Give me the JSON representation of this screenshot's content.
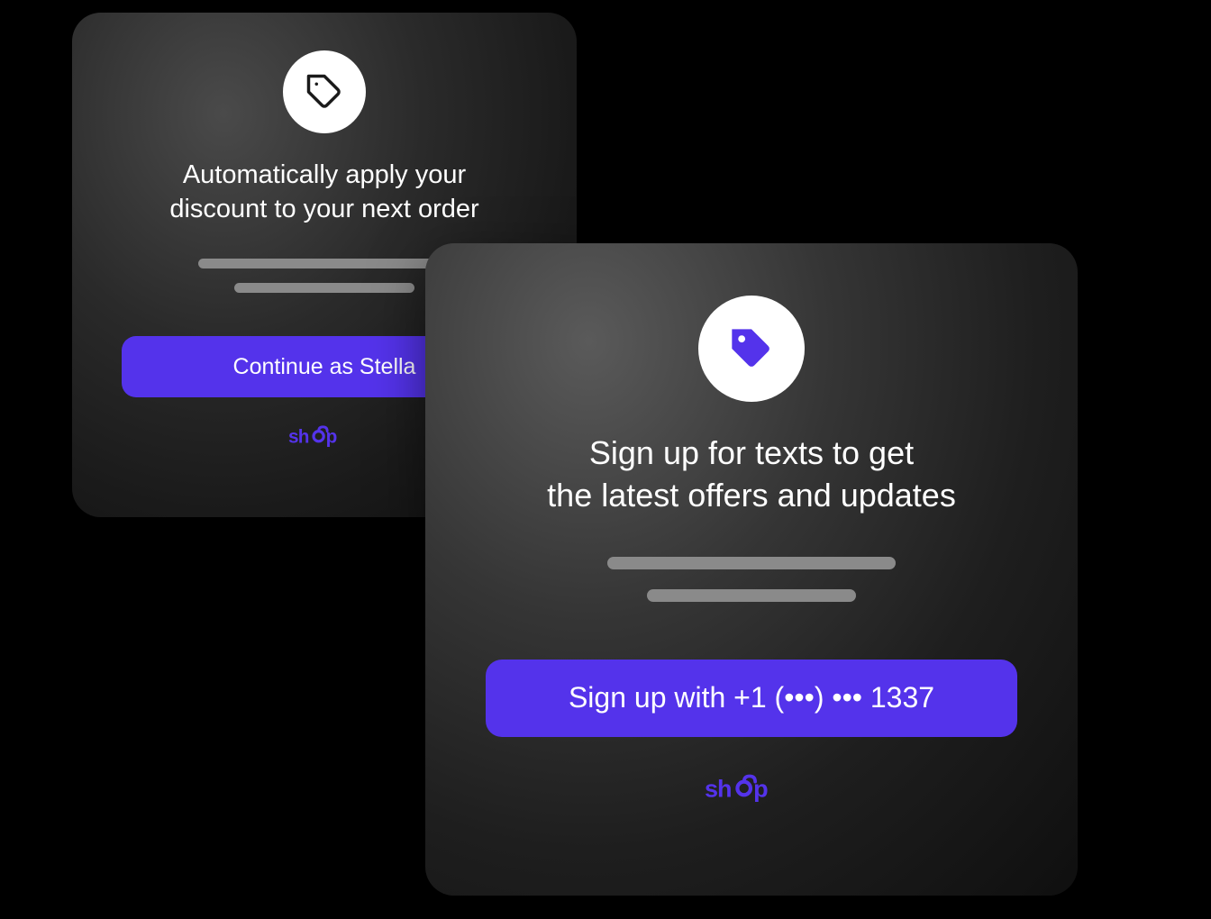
{
  "cards": {
    "left": {
      "heading": "Automatically apply your\ndiscount to your next order",
      "cta_label": "Continue as Stella",
      "icon_name": "tag-icon",
      "icon_color": "#1a1a1a",
      "brand_label": "shop"
    },
    "right": {
      "heading": "Sign up for texts to get\nthe latest offers and updates",
      "cta_label": "Sign up with +1 (•••) ••• 1337",
      "icon_name": "tag-icon",
      "icon_color": "#5433EB",
      "brand_label": "shop"
    }
  },
  "colors": {
    "accent": "#5433EB",
    "background": "#000000",
    "text": "#ffffff"
  }
}
